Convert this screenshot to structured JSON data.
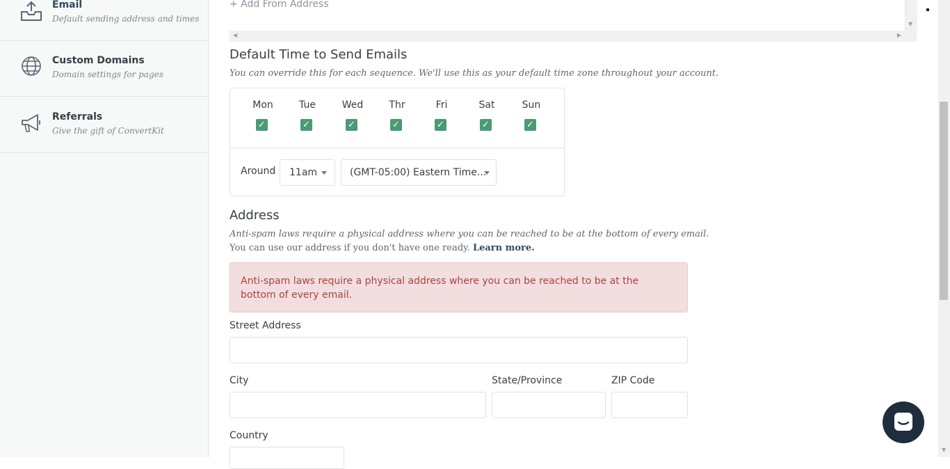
{
  "sidebar": {
    "items": [
      {
        "title": "Email",
        "subtitle": "Default sending address and times"
      },
      {
        "title": "Custom Domains",
        "subtitle": "Domain settings for pages"
      },
      {
        "title": "Referrals",
        "subtitle": "Give the gift of ConvertKit"
      }
    ]
  },
  "from_address": {
    "add_link": "+ Add From Address"
  },
  "send_time": {
    "heading": "Default Time to Send Emails",
    "note": "You can override this for each sequence. We'll use this as your default time zone throughout your account.",
    "days": [
      {
        "label": "Mon",
        "checked": true
      },
      {
        "label": "Tue",
        "checked": true
      },
      {
        "label": "Wed",
        "checked": true
      },
      {
        "label": "Thr",
        "checked": true
      },
      {
        "label": "Fri",
        "checked": true
      },
      {
        "label": "Sat",
        "checked": true
      },
      {
        "label": "Sun",
        "checked": true
      }
    ],
    "around_label": "Around",
    "time_value": "11am",
    "timezone_value": "(GMT-05:00) Eastern Time..."
  },
  "address": {
    "heading": "Address",
    "note_line1": "Anti-spam laws require a physical address where you can be reached to be at the bottom of every email.",
    "note_line2": "You can use our address if you don't have one ready.",
    "learn_more": "Learn more.",
    "alert": "Anti-spam laws require a physical address where you can be reached to be at the bottom of every email.",
    "street_label": "Street Address",
    "city_label": "City",
    "state_label": "State/Province",
    "zip_label": "ZIP Code",
    "country_label": "Country"
  },
  "colors": {
    "accent": "#4a9a73",
    "alert_bg": "#f2dede",
    "alert_text": "#a94442",
    "chat": "#1f2d3d"
  }
}
